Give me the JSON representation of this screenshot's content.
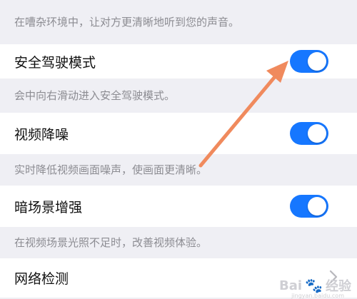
{
  "items": [
    {
      "kind": "desc",
      "text": "在嘈杂环境中，让对方更清晰地听到您的声音。"
    },
    {
      "kind": "row",
      "label": "安全驾驶模式",
      "toggle": "on"
    },
    {
      "kind": "desc",
      "text": "会中向右滑动进入安全驾驶模式。"
    },
    {
      "kind": "row",
      "label": "视频降噪",
      "toggle": "on"
    },
    {
      "kind": "desc",
      "text": "实时降低视频画面噪声，使画面更清晰。"
    },
    {
      "kind": "row",
      "label": "暗场景增强",
      "toggle": "on"
    },
    {
      "kind": "desc",
      "text": "在视频场景光照不足时，改善视频体验。"
    },
    {
      "kind": "row",
      "label": "网络检测"
    }
  ],
  "watermark": {
    "brand": "Bai",
    "suffix": "经验",
    "url": "jingyan.baidu.com"
  },
  "colors": {
    "accent": "#1677ff",
    "arrow": "#f08a5d",
    "background": "#efeff4"
  }
}
